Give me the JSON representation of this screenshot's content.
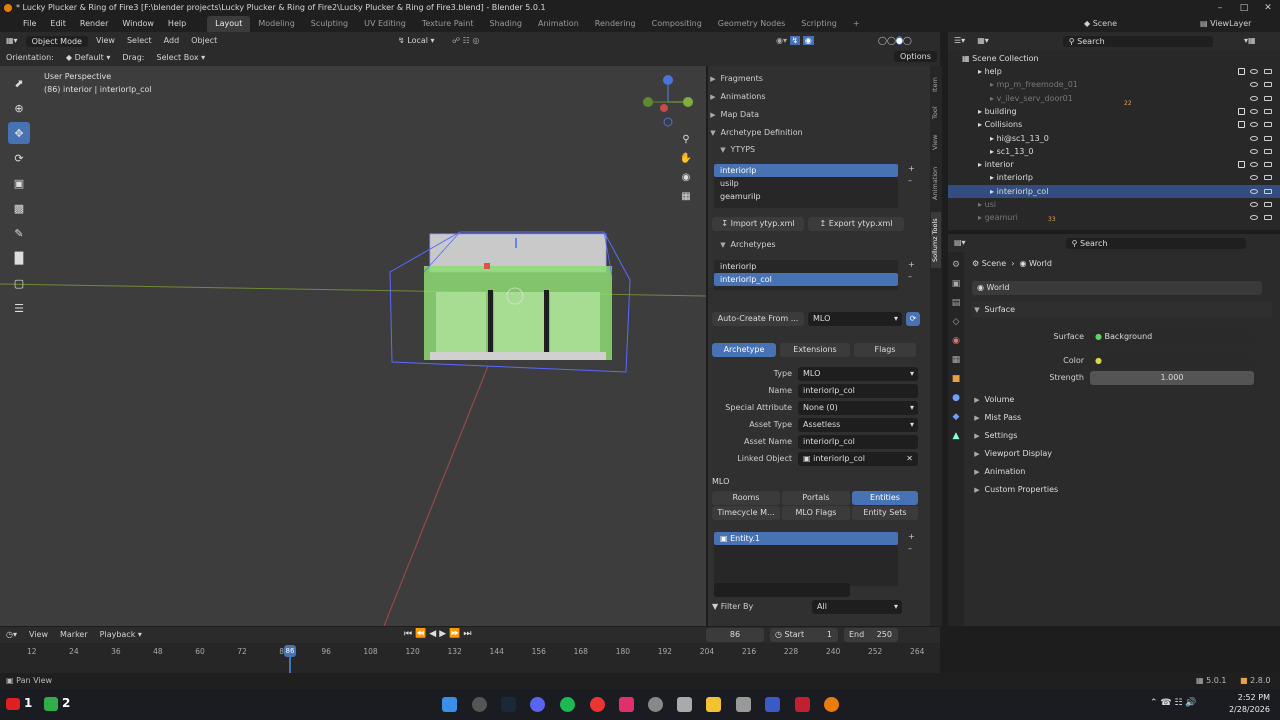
{
  "window": {
    "title": "* Lucky Plucker & Ring of Fire3 [F:\\blender projects\\Lucky Plucker & Ring of Fire2\\Lucky Plucker & Ring of Fire3.blend] - Blender 5.0.1"
  },
  "menu": [
    "File",
    "Edit",
    "Render",
    "Window",
    "Help"
  ],
  "workspaces": [
    "Layout",
    "Modeling",
    "Sculpting",
    "UV Editing",
    "Texture Paint",
    "Shading",
    "Animation",
    "Rendering",
    "Compositing",
    "Geometry Nodes",
    "Scripting"
  ],
  "active_workspace": "Layout",
  "vp_header": {
    "mode": "Object Mode",
    "menus": [
      "View",
      "Select",
      "Add",
      "Object"
    ],
    "transform": "Local",
    "options": "Options"
  },
  "vp_header2": {
    "orientation_label": "Orientation:",
    "orientation": "Default",
    "drag_label": "Drag:",
    "drag": "Select Box"
  },
  "viewport": {
    "perspective": "User Perspective",
    "object": "(86) interior | interiorlp_col"
  },
  "npanel": {
    "sections": [
      "Fragments",
      "Animations",
      "Map Data",
      "Archetype Definition"
    ],
    "ytyps_label": "YTYPS",
    "ytyps": [
      "interiorlp",
      "usilp",
      "geamurilp"
    ],
    "import_btn": "Import ytyp.xml",
    "export_btn": "Export ytyp.xml",
    "archetypes_label": "Archetypes",
    "archetypes": [
      "interiorlp",
      "interiorlp_col"
    ],
    "autocreate": "Auto-Create From ...",
    "autocreate_type": "MLO",
    "tabs": [
      "Archetype",
      "Extensions",
      "Flags"
    ],
    "props": [
      {
        "label": "Type",
        "value": "MLO"
      },
      {
        "label": "Name",
        "value": "interiorlp_col"
      },
      {
        "label": "Special Attribute",
        "value": "None (0)"
      },
      {
        "label": "Asset Type",
        "value": "Assetless"
      },
      {
        "label": "Asset Name",
        "value": "interiorlp_col"
      },
      {
        "label": "Linked Object",
        "value": "interiorlp_col"
      }
    ],
    "mlo_label": "MLO",
    "mlo_tabs": [
      "Rooms",
      "Portals",
      "Entities",
      "Timecycle M...",
      "MLO Flags",
      "Entity Sets"
    ],
    "entities": [
      "Entity.1"
    ],
    "filter_label": "Filter By",
    "filter_value": "All"
  },
  "vtabs": [
    "Item",
    "Tool",
    "View",
    "Animation",
    "Sollumz Tools"
  ],
  "outliner": {
    "search": "Search",
    "scene_collection": "Scene Collection",
    "items": [
      {
        "name": "help",
        "indent": 1,
        "dim": false,
        "sel": false
      },
      {
        "name": "mp_m_freemode_01",
        "indent": 2,
        "dim": true,
        "sel": false
      },
      {
        "name": "v_ilev_serv_door01",
        "indent": 2,
        "dim": true,
        "sel": false
      },
      {
        "name": "building",
        "indent": 1,
        "dim": false,
        "sel": false
      },
      {
        "name": "Collisions",
        "indent": 1,
        "dim": false,
        "sel": false
      },
      {
        "name": "hi@sc1_13_0",
        "indent": 2,
        "dim": false,
        "sel": false
      },
      {
        "name": "sc1_13_0",
        "indent": 2,
        "dim": false,
        "sel": false
      },
      {
        "name": "interior",
        "indent": 1,
        "dim": false,
        "sel": false
      },
      {
        "name": "interiorlp",
        "indent": 2,
        "dim": false,
        "sel": false
      },
      {
        "name": "interiorlp_col",
        "indent": 2,
        "dim": false,
        "sel": true
      },
      {
        "name": "usi",
        "indent": 1,
        "dim": true,
        "sel": false
      },
      {
        "name": "geamuri",
        "indent": 1,
        "dim": true,
        "sel": false
      }
    ],
    "badges": [
      "22",
      "33"
    ]
  },
  "top_right": {
    "scene": "Scene",
    "view_layer": "ViewLayer"
  },
  "properties": {
    "search": "Search",
    "breadcrumb": [
      "Scene",
      "World"
    ],
    "world_name": "World",
    "surface_section": "Surface",
    "surface_label": "Surface",
    "surface_value": "Background",
    "color_label": "Color",
    "strength_label": "Strength",
    "strength_value": "1.000",
    "sections": [
      "Volume",
      "Mist Pass",
      "Settings",
      "Viewport Display",
      "Animation",
      "Custom Properties"
    ]
  },
  "timeline": {
    "menus": [
      "View",
      "Marker",
      "Playback"
    ],
    "current": "86",
    "start_label": "Start",
    "start": "1",
    "end_label": "End",
    "end": "250",
    "ticks": [
      "12",
      "24",
      "36",
      "48",
      "60",
      "72",
      "84",
      "96",
      "108",
      "120",
      "132",
      "144",
      "156",
      "168",
      "180",
      "192",
      "204",
      "216",
      "228",
      "240",
      "252",
      "264"
    ]
  },
  "status": {
    "left": "Pan View",
    "version": "5.0.1",
    "fps": "2.8.0"
  },
  "taskbar": {
    "time": "2:52 PM",
    "date": "2/28/2026",
    "num1": "1",
    "num2": "2"
  }
}
